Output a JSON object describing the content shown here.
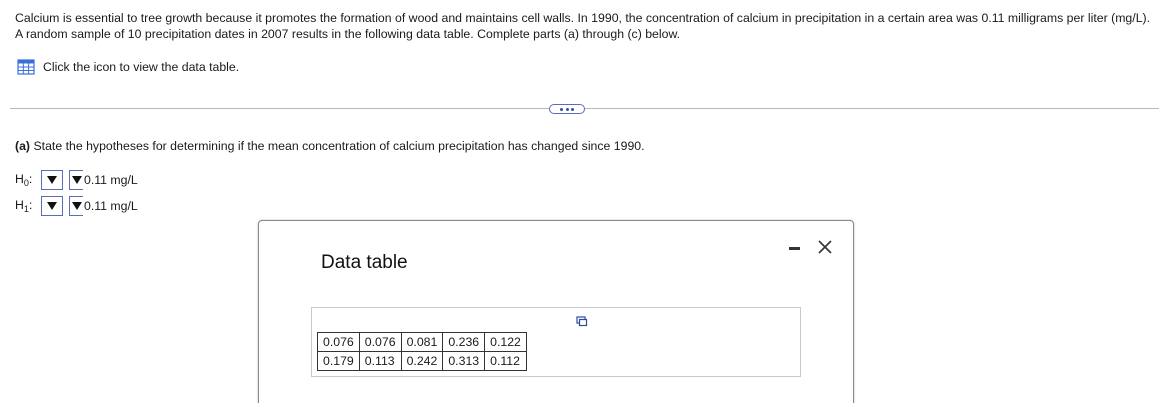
{
  "problem": {
    "text": "Calcium is essential to tree growth because it promotes the formation of wood and maintains cell walls. In 1990, the concentration of calcium in precipitation in a certain area was 0.11 milligrams per liter (mg/L). A random sample of 10 precipitation dates in 2007 results in the following data table. Complete parts (a) through (c) below.",
    "data_link": "Click the icon to view the data table.",
    "data_icon": "grid-table-icon"
  },
  "part_a": {
    "question_bold": "(a)",
    "question_text": " State the hypotheses for determining if the mean concentration of calcium precipitation has changed since 1990.",
    "h0": {
      "label": "H",
      "sub": "0",
      "colon": ":",
      "value": "0.11 mg/L"
    },
    "h1": {
      "label": "H",
      "sub": "1",
      "colon": ":",
      "value": "0.11 mg/L"
    }
  },
  "dialog": {
    "title": "Data table",
    "rows": [
      [
        "0.076",
        "0.076",
        "0.081",
        "0.236",
        "0.122"
      ],
      [
        "0.179",
        "0.113",
        "0.242",
        "0.313",
        "0.112"
      ]
    ]
  },
  "colors": {
    "accent": "#5a6eb8",
    "icon_blue": "#3a6fd8"
  }
}
